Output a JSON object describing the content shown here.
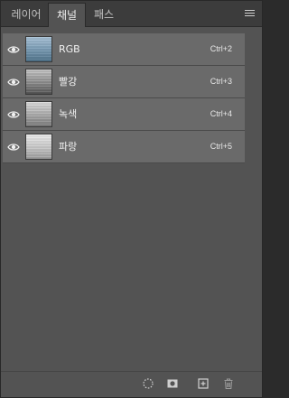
{
  "tabs": [
    {
      "label": "레이어"
    },
    {
      "label": "채널"
    },
    {
      "label": "패스"
    }
  ],
  "active_tab": "채널",
  "channels": [
    {
      "name": "RGB",
      "shortcut": "Ctrl+2",
      "visible": true,
      "thumbnail": "rgb-composite"
    },
    {
      "name": "빨강",
      "shortcut": "Ctrl+3",
      "visible": true,
      "thumbnail": "red-grayscale"
    },
    {
      "name": "녹색",
      "shortcut": "Ctrl+4",
      "visible": true,
      "thumbnail": "green-grayscale"
    },
    {
      "name": "파랑",
      "shortcut": "Ctrl+5",
      "visible": true,
      "thumbnail": "blue-grayscale"
    }
  ],
  "footer_icons": [
    "load-selection-icon",
    "save-selection-icon",
    "new-channel-icon",
    "trash-icon"
  ],
  "colors": {
    "panel_bg": "#535353",
    "row_bg": "#6a6a6a",
    "tab_bar_bg": "#3c3c3c",
    "text": "#f2f2f2"
  }
}
